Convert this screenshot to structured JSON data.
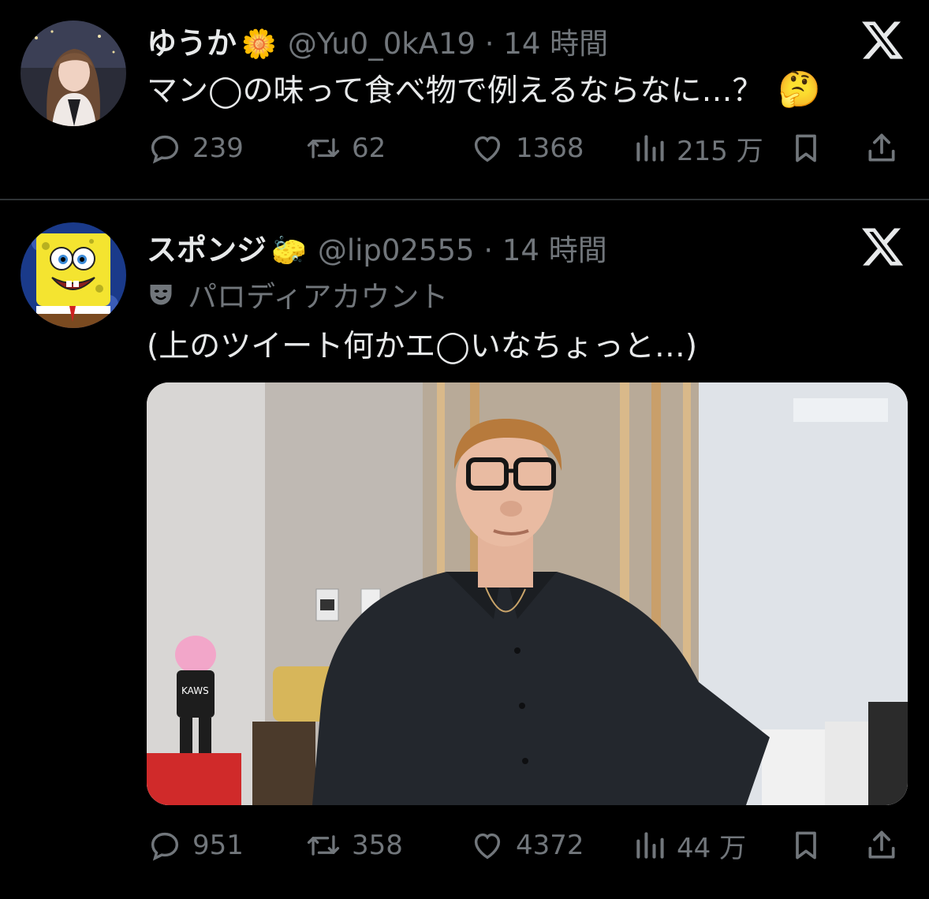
{
  "tweets": [
    {
      "display_name": "ゆうか",
      "name_emoji": "🌼",
      "handle_time": "@Yu0_0kA19 · 14 時間",
      "text": "マン◯の味って食べ物で例えるならなに…？",
      "text_emoji": "🤔",
      "stats": {
        "replies": "239",
        "retweets": "62",
        "likes": "1368",
        "views": "215 万"
      },
      "avatar_icon": "profile-photo-woman",
      "network_icon": "x-logo-icon"
    },
    {
      "display_name": "スポンジ",
      "name_emoji": "🧽",
      "handle_time": "@lip02555 · 14 時間",
      "parody_label": "パロディアカウント",
      "parody_icon": "theater-mask-icon",
      "text": "(上のツイート何かエ◯いなちょっと…)",
      "media_icon": "photo-man-in-glasses-looking-up",
      "media_caption": "KAWS",
      "stats": {
        "replies": "951",
        "retweets": "358",
        "likes": "4372",
        "views": "44 万"
      },
      "avatar_icon": "spongebob-avatar",
      "network_icon": "x-logo-icon"
    }
  ],
  "colors": {
    "background": "#000000",
    "text": "#e7e9ea",
    "muted": "#71767b",
    "divider": "#2f3336"
  }
}
